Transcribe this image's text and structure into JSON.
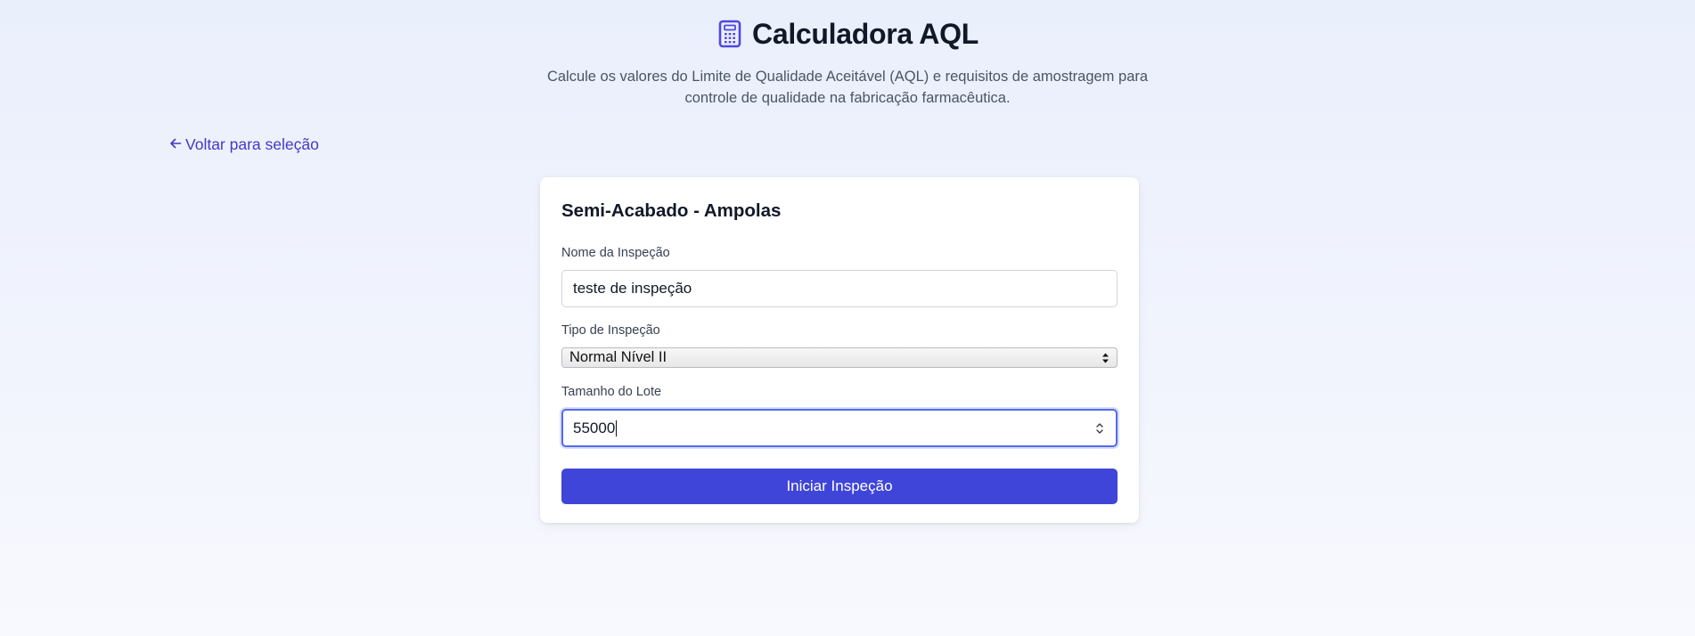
{
  "header": {
    "title": "Calculadora AQL",
    "subtitle": "Calcule os valores do Limite de Qualidade Aceitável (AQL) e requisitos de amostragem para controle de qualidade na fabricação farmacêutica.",
    "icon": "calculator-icon"
  },
  "nav": {
    "back_label": "Voltar para seleção",
    "back_icon": "arrow-left-icon"
  },
  "form": {
    "title": "Semi-Acabado - Ampolas",
    "inspection_name": {
      "label": "Nome da Inspeção",
      "value": "teste de inspeção"
    },
    "inspection_type": {
      "label": "Tipo de Inspeção",
      "selected": "Normal Nível II"
    },
    "lot_size": {
      "label": "Tamanho do Lote",
      "value": "55000"
    },
    "submit_label": "Iniciar Inspeção"
  },
  "colors": {
    "accent": "#4045d9",
    "link": "#4338ca",
    "focus_border": "#4f6bed"
  }
}
